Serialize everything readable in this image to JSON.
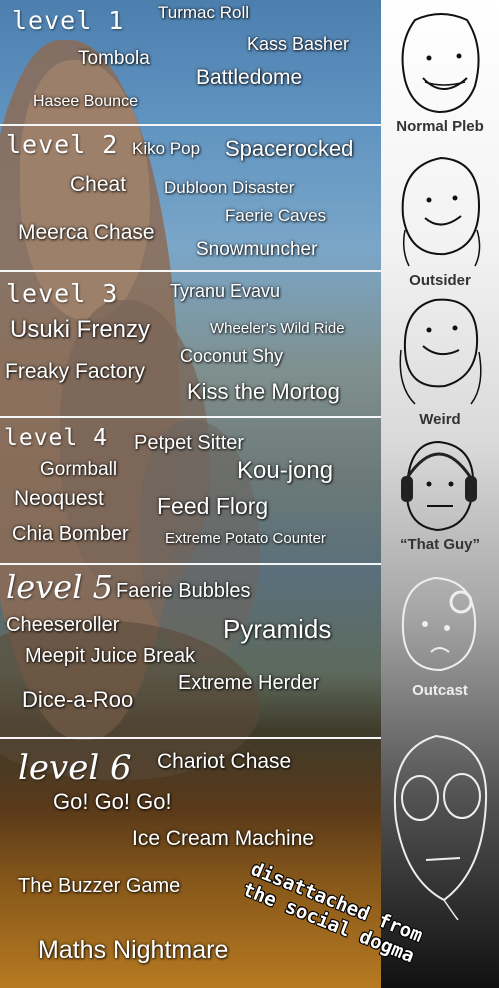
{
  "levels": [
    {
      "label": "level 1",
      "games": [
        "Turmac Roll",
        "Kass Basher",
        "Tombola",
        "Battledome",
        "Hasee Bounce"
      ]
    },
    {
      "label": "level 2",
      "games": [
        "Kiko Pop",
        "Spacerocked",
        "Cheat",
        "Dubloon Disaster",
        "Faerie Caves",
        "Meerca Chase",
        "Snowmuncher"
      ]
    },
    {
      "label": "level 3",
      "games": [
        "Tyranu Evavu",
        "Usuki Frenzy",
        "Wheeler's Wild Ride",
        "Coconut Shy",
        "Freaky Factory",
        "Kiss the Mortog"
      ]
    },
    {
      "label": "level 4",
      "games": [
        "Petpet Sitter",
        "Gormball",
        "Kou-jong",
        "Neoquest",
        "Feed Florg",
        "Chia Bomber",
        "Extreme Potato Counter"
      ]
    },
    {
      "label": "level 5",
      "games": [
        "Faerie Bubbles",
        "Cheeseroller",
        "Pyramids",
        "Meepit Juice Break",
        "Extreme Herder",
        "Dice-a-Roo"
      ]
    },
    {
      "label": "level 6",
      "games": [
        "Chariot Chase",
        "Go! Go! Go!",
        "Ice Cream Machine",
        "The Buzzer Game",
        "Maths Nightmare"
      ]
    }
  ],
  "ranks": [
    "Normal Pleb",
    "Outsider",
    "Weird",
    "“That Guy”",
    "Outcast"
  ],
  "stamp": [
    "disattached from",
    "the social dogma"
  ]
}
